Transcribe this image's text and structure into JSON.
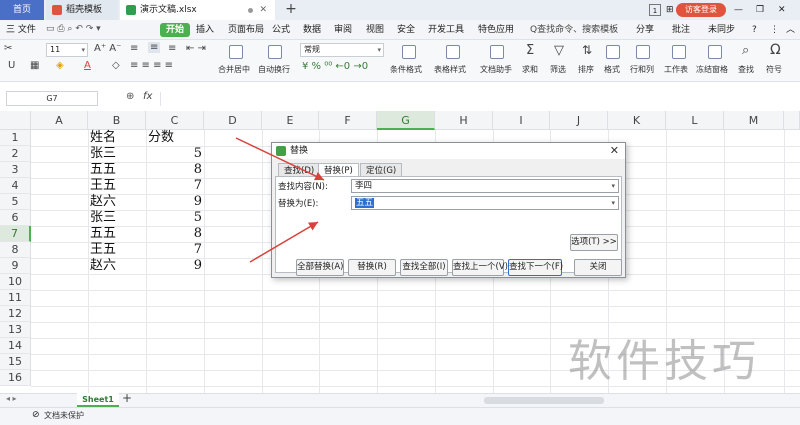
{
  "titlebar": {
    "tabs": [
      {
        "label": "首页"
      },
      {
        "label": "稻壳模板"
      },
      {
        "label": "演示文稿.xlsx"
      }
    ],
    "page_count": "1",
    "visitor_login": "访客登录"
  },
  "menubar": {
    "file": "三 文件",
    "start": "开始",
    "items": [
      "插入",
      "页面布局",
      "公式",
      "数据",
      "审阅",
      "视图",
      "安全",
      "开发工具",
      "特色应用"
    ],
    "search": "Q查找命令、搜索模板",
    "share": "分享",
    "comment": "批注",
    "sync": "未同步"
  },
  "ribbon": {
    "font_size": "11",
    "number_format": "常规",
    "buttons": [
      "合并居中",
      "自动换行",
      "条件格式",
      "表格样式",
      "文档助手",
      "求和",
      "筛选",
      "排序",
      "格式",
      "行和列",
      "工作表",
      "冻结窗格",
      "查找",
      "符号"
    ]
  },
  "formulabar": {
    "namebox": "G7",
    "fx": "fx"
  },
  "grid": {
    "columns": [
      "A",
      "B",
      "C",
      "D",
      "E",
      "F",
      "G",
      "H",
      "I",
      "J",
      "K",
      "L",
      "M"
    ],
    "rows": [
      "1",
      "2",
      "3",
      "4",
      "5",
      "6",
      "7",
      "8",
      "9",
      "10",
      "11",
      "12",
      "13",
      "14",
      "15",
      "16"
    ],
    "selected_column": "G",
    "selected_row": "7",
    "header_name": "姓名",
    "header_score": "分数",
    "data": [
      {
        "name": "张三",
        "score": "5"
      },
      {
        "name": "五五",
        "score": "8"
      },
      {
        "name": "王五",
        "score": "7"
      },
      {
        "name": "赵六",
        "score": "9"
      },
      {
        "name": "张三",
        "score": "5"
      },
      {
        "name": "五五",
        "score": "8"
      },
      {
        "name": "王五",
        "score": "7"
      },
      {
        "name": "赵六",
        "score": "9"
      }
    ]
  },
  "sheets": {
    "active": "Sheet1",
    "add": "+"
  },
  "status": {
    "protect": "文档未保护"
  },
  "dialog": {
    "title": "替换",
    "tabs": [
      "查找(D)",
      "替换(P)",
      "定位(G)"
    ],
    "find_label": "查找内容(N):",
    "find_value": "李四",
    "replace_label": "替换为(E):",
    "replace_value": "五五",
    "options": "选项(T) >>",
    "buttons": [
      "全部替换(A)",
      "替换(R)",
      "查找全部(I)",
      "查找上一个(V)",
      "查找下一个(F)",
      "关闭"
    ]
  },
  "watermark": "软件技巧",
  "colors": {
    "accent": "#4caf50",
    "brand_blue": "#4a6fc7",
    "arrow": "#d9413b"
  }
}
